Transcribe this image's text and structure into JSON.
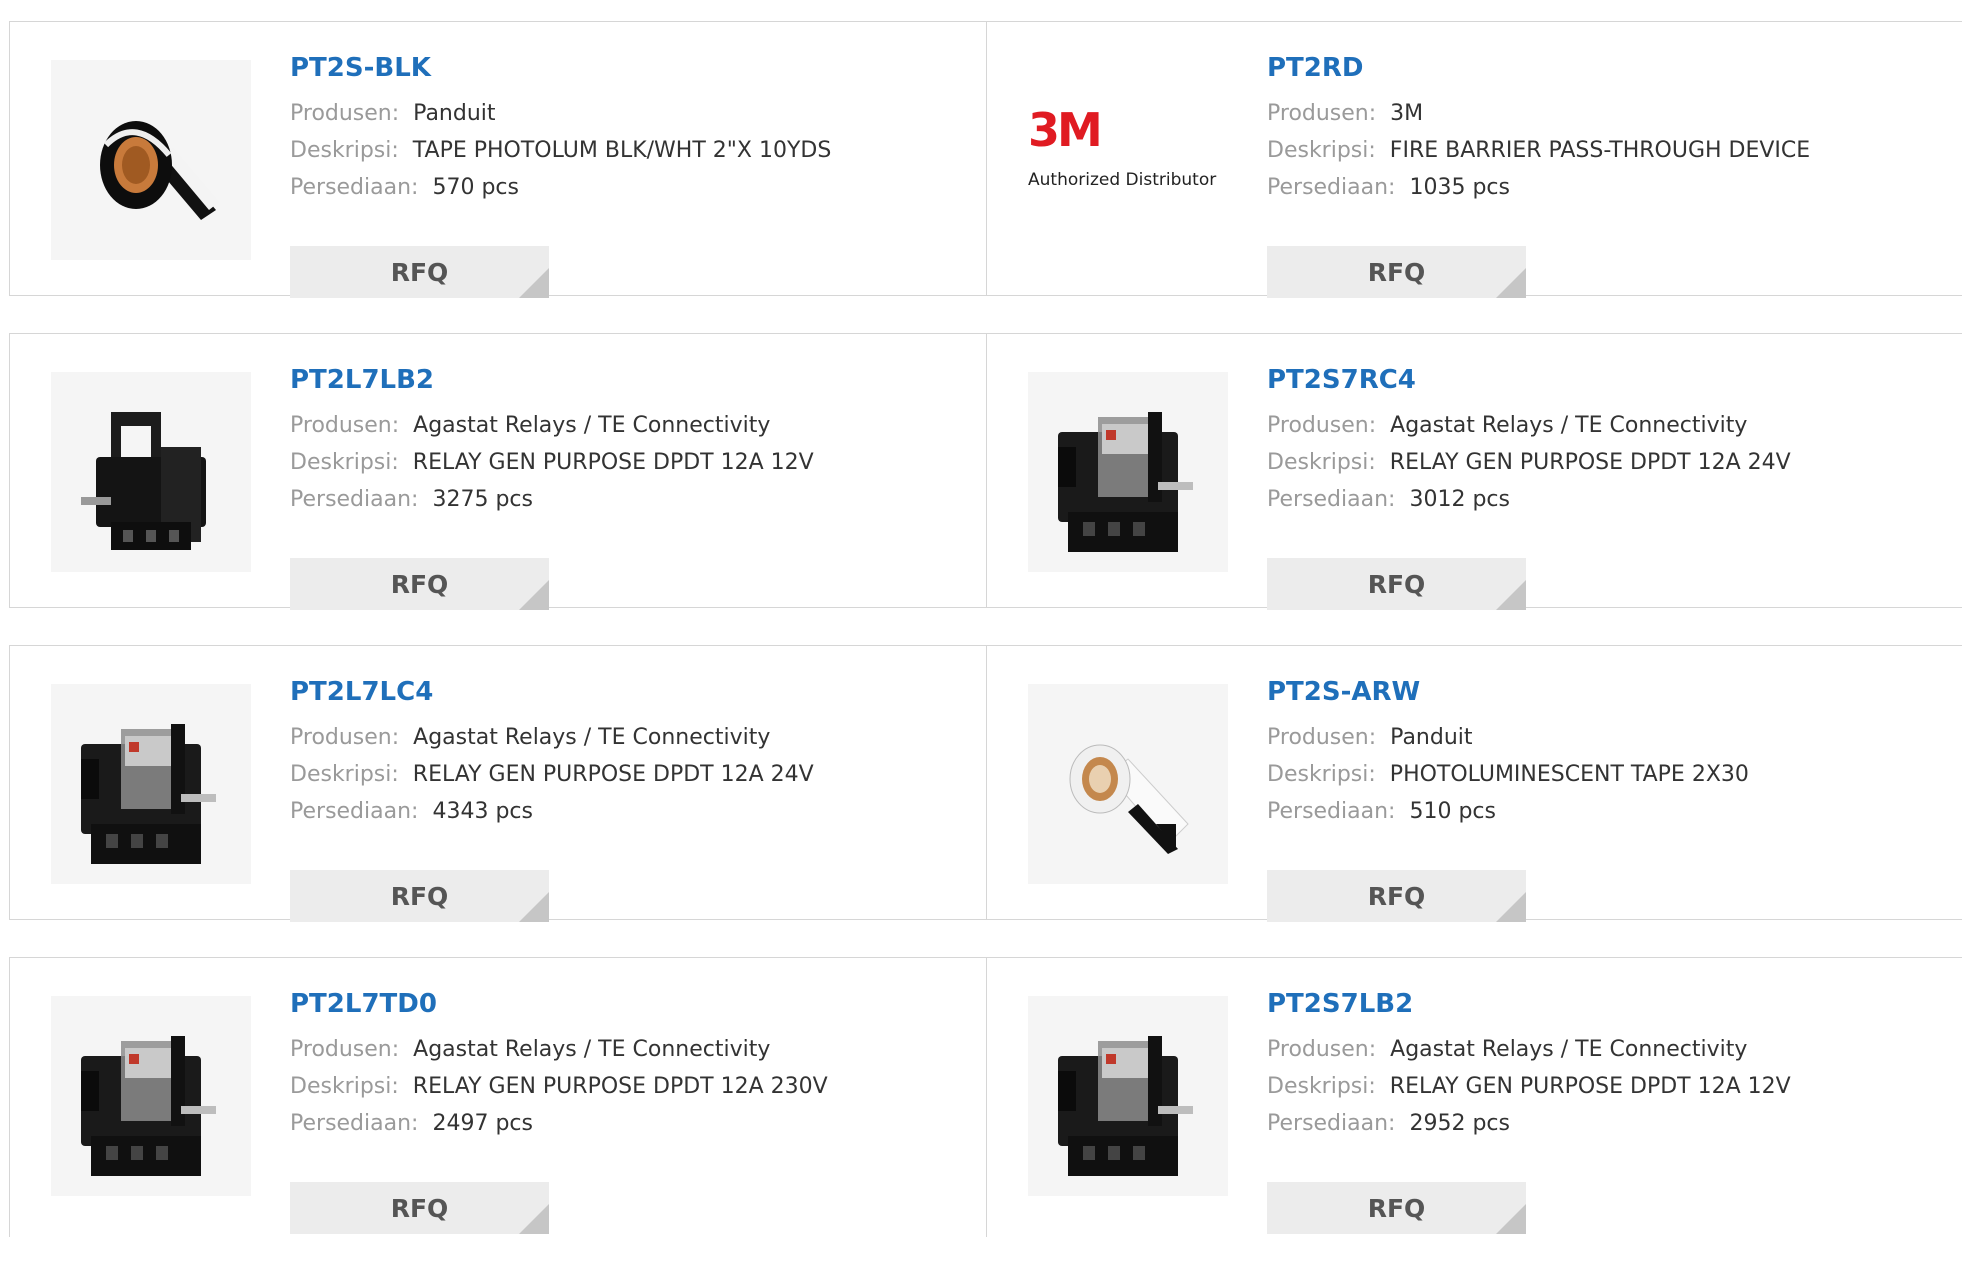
{
  "labels": {
    "manufacturer": "Produsen:",
    "description": "Deskripsi:",
    "stock": "Persediaan:",
    "rfq": "RFQ"
  },
  "products": [
    {
      "part": "PT2S-BLK",
      "manufacturer": "Panduit",
      "description": "TAPE PHOTOLUM BLK/WHT 2\"X 10YDS",
      "stock": "570 pcs",
      "image": "tape-roll-black-image"
    },
    {
      "part": "PT2RD",
      "manufacturer": "3M",
      "description": "FIRE BARRIER PASS-THROUGH DEVICE",
      "stock": "1035 pcs",
      "image": "3m-logo-image",
      "logo": {
        "mark": "3M",
        "caption": "Authorized Distributor",
        "color": "#e01b22"
      }
    },
    {
      "part": "PT2L7LB2",
      "manufacturer": "Agastat Relays / TE Connectivity",
      "description": "RELAY GEN PURPOSE DPDT 12A 12V",
      "stock": "3275 pcs",
      "image": "relay-socket-image"
    },
    {
      "part": "PT2S7RC4",
      "manufacturer": "Agastat Relays / TE Connectivity",
      "description": "RELAY GEN PURPOSE DPDT 12A 24V",
      "stock": "3012 pcs",
      "image": "relay-image"
    },
    {
      "part": "PT2L7LC4",
      "manufacturer": "Agastat Relays / TE Connectivity",
      "description": "RELAY GEN PURPOSE DPDT 12A 24V",
      "stock": "4343 pcs",
      "image": "relay-image"
    },
    {
      "part": "PT2S-ARW",
      "manufacturer": "Panduit",
      "description": "PHOTOLUMINESCENT TAPE 2X30",
      "stock": "510 pcs",
      "image": "tape-roll-arrow-image"
    },
    {
      "part": "PT2L7TD0",
      "manufacturer": "Agastat Relays / TE Connectivity",
      "description": "RELAY GEN PURPOSE DPDT 12A 230V",
      "stock": "2497 pcs",
      "image": "relay-image"
    },
    {
      "part": "PT2S7LB2",
      "manufacturer": "Agastat Relays / TE Connectivity",
      "description": "RELAY GEN PURPOSE DPDT 12A 12V",
      "stock": "2952 pcs",
      "image": "relay-image"
    }
  ],
  "colors": {
    "part_link": "#1f6fba",
    "label": "#9a9a9a",
    "value": "#333333",
    "rfq_bg": "#ececec",
    "border": "#d6d6d6"
  }
}
